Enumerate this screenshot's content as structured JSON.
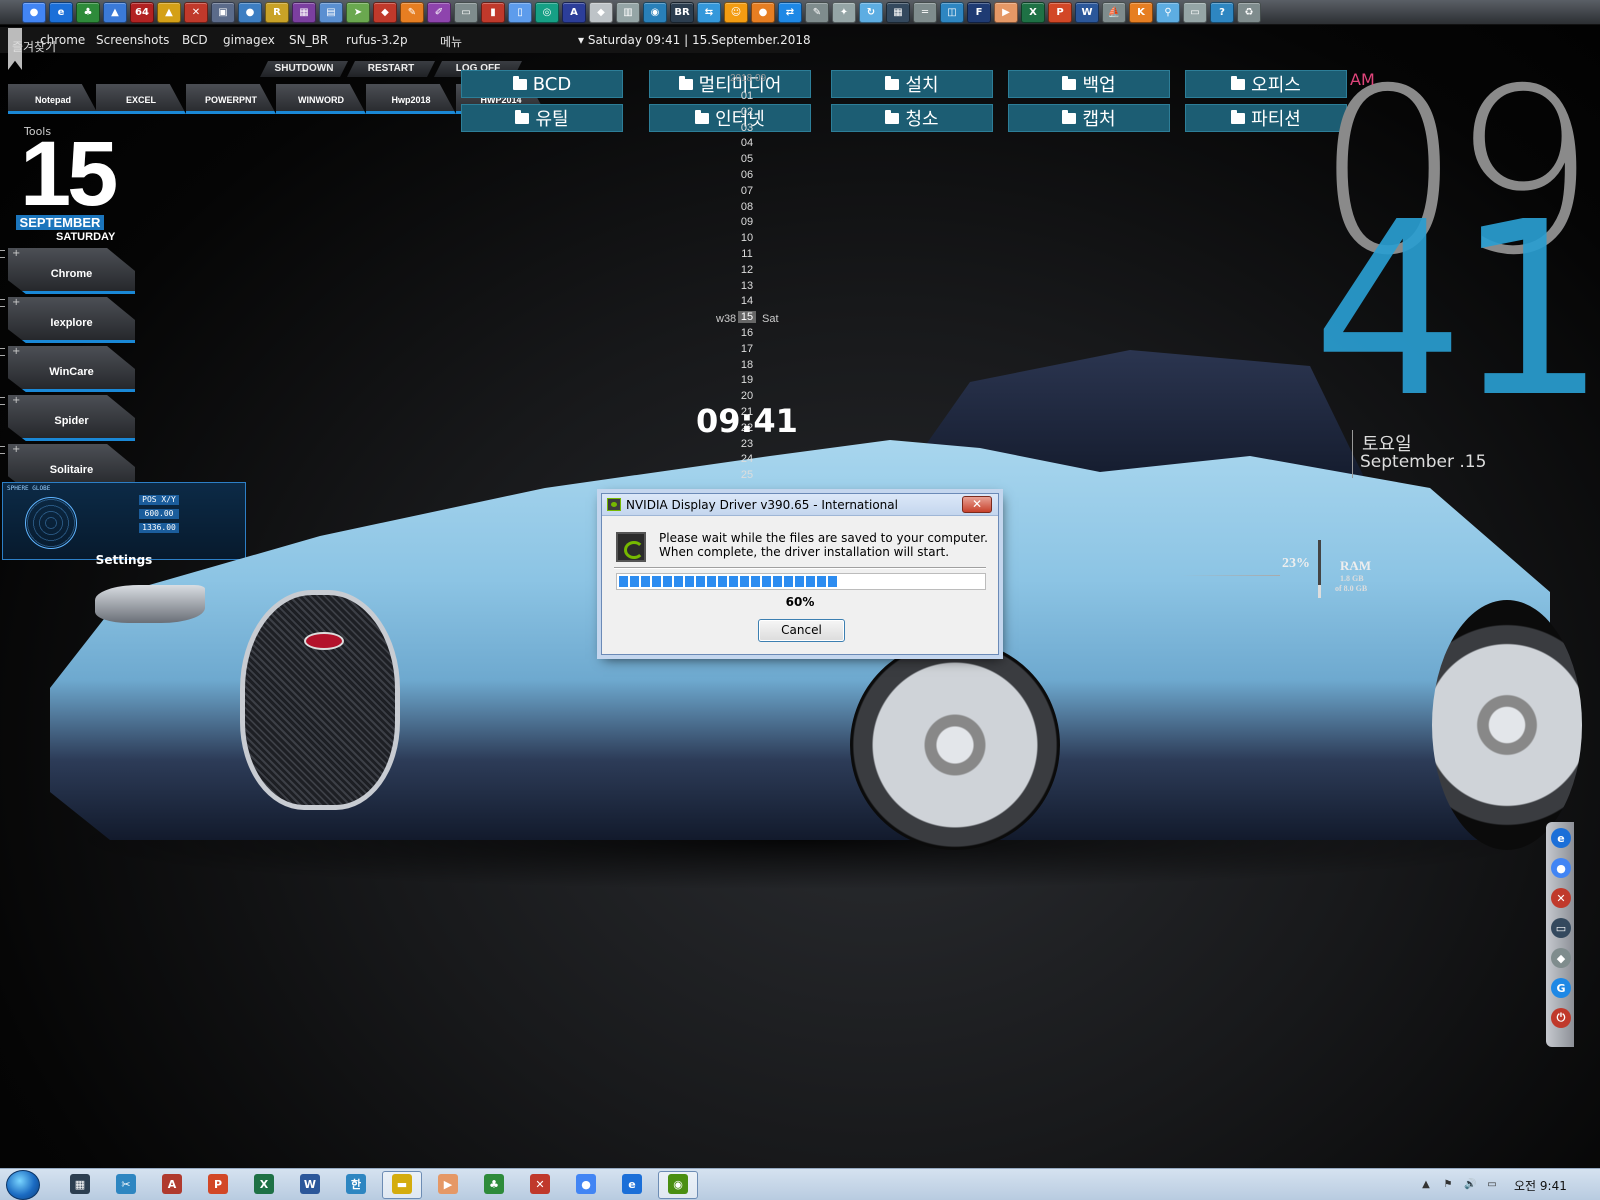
{
  "top_icons": [
    {
      "name": "chrome-icon",
      "color": "#4285f4",
      "glyph": "●"
    },
    {
      "name": "ie-icon",
      "color": "#1b6fd8",
      "glyph": "e"
    },
    {
      "name": "clover-icon",
      "color": "#2e8b3a",
      "glyph": "♣"
    },
    {
      "name": "drive-icon",
      "color": "#3b7ad8",
      "glyph": "▲"
    },
    {
      "name": "cpu64-icon",
      "color": "#b22222",
      "glyph": "64"
    },
    {
      "name": "hazard-icon",
      "color": "#d4a017",
      "glyph": "▲"
    },
    {
      "name": "tool-icon",
      "color": "#c0392b",
      "glyph": "✕"
    },
    {
      "name": "scanner-icon",
      "color": "#5b6b8a",
      "glyph": "▣"
    },
    {
      "name": "drop-icon",
      "color": "#3d7ec2",
      "glyph": "●"
    },
    {
      "name": "r-icon",
      "color": "#c9a227",
      "glyph": "R"
    },
    {
      "name": "rar-icon",
      "color": "#7b3fa0",
      "glyph": "▦"
    },
    {
      "name": "disk-icon",
      "color": "#5a8fd1",
      "glyph": "▤"
    },
    {
      "name": "bird-icon",
      "color": "#6aa84f",
      "glyph": "➤"
    },
    {
      "name": "shield-icon",
      "color": "#c0392b",
      "glyph": "◆"
    },
    {
      "name": "pen-icon",
      "color": "#e67e22",
      "glyph": "✎"
    },
    {
      "name": "brush-icon",
      "color": "#8e44ad",
      "glyph": "✐"
    },
    {
      "name": "card-icon",
      "color": "#7f8c8d",
      "glyph": "▭"
    },
    {
      "name": "paper-icon",
      "color": "#c0392b",
      "glyph": "▮"
    },
    {
      "name": "doc-icon",
      "color": "#5d9cec",
      "glyph": "▯"
    },
    {
      "name": "cd-icon",
      "color": "#16a085",
      "glyph": "◎"
    },
    {
      "name": "a-icon",
      "color": "#2c3e99",
      "glyph": "A"
    },
    {
      "name": "diamond-icon",
      "color": "#bdc3c7",
      "glyph": "◆"
    },
    {
      "name": "printer-icon",
      "color": "#95a5a6",
      "glyph": "▥"
    },
    {
      "name": "globe-icon",
      "color": "#2980b9",
      "glyph": "◉"
    },
    {
      "name": "br-icon",
      "color": "#2c3e50",
      "glyph": "BR"
    },
    {
      "name": "net-icon",
      "color": "#3498db",
      "glyph": "⇆"
    },
    {
      "name": "users-icon",
      "color": "#f39c12",
      "glyph": "☺"
    },
    {
      "name": "orange-icon",
      "color": "#e67e22",
      "glyph": "●"
    },
    {
      "name": "remote-icon",
      "color": "#1e88e5",
      "glyph": "⇄"
    },
    {
      "name": "pencil-icon",
      "color": "#7f8c8d",
      "glyph": "✎"
    },
    {
      "name": "wand-icon",
      "color": "#95a5a6",
      "glyph": "✦"
    },
    {
      "name": "refresh-icon",
      "color": "#5dade2",
      "glyph": "↻"
    },
    {
      "name": "calc-icon",
      "color": "#34495e",
      "glyph": "▦"
    },
    {
      "name": "pipe-icon",
      "color": "#7f8c8d",
      "glyph": "═"
    },
    {
      "name": "panel-icon",
      "color": "#2e86c1",
      "glyph": "◫"
    },
    {
      "name": "f-icon",
      "color": "#1f3b73",
      "glyph": "F"
    },
    {
      "name": "play-icon",
      "color": "#e59866",
      "glyph": "▶"
    },
    {
      "name": "excel-icon",
      "color": "#1e7145",
      "glyph": "X"
    },
    {
      "name": "ppt-icon",
      "color": "#d24726",
      "glyph": "P"
    },
    {
      "name": "word-icon",
      "color": "#2b579a",
      "glyph": "W"
    },
    {
      "name": "ship-icon",
      "color": "#7f8c8d",
      "glyph": "⛵"
    },
    {
      "name": "k-icon",
      "color": "#e67e22",
      "glyph": "K"
    },
    {
      "name": "magnify-icon",
      "color": "#5dade2",
      "glyph": "⚲"
    },
    {
      "name": "monitor-icon",
      "color": "#95a5a6",
      "glyph": "▭"
    },
    {
      "name": "help-icon",
      "color": "#2e86c1",
      "glyph": "?"
    },
    {
      "name": "recycle-icon",
      "color": "#7f8c8d",
      "glyph": "♻"
    }
  ],
  "menu": {
    "shortcut_korean": "즐겨찾기",
    "items": [
      "chrome",
      "Screenshots",
      "BCD",
      "gimagex",
      "SN_BR",
      "rufus-3.2p",
      "메뉴"
    ],
    "clock": "▾ Saturday 09:41 | 15.September.2018"
  },
  "power_buttons": [
    "SHUTDOWN",
    "RESTART",
    "LOG OFF"
  ],
  "app_tabs": [
    "Notepad",
    "EXCEL",
    "POWERPNT",
    "WINWORD",
    "Hwp2018",
    "HWP2014"
  ],
  "folders": [
    [
      "BCD",
      "멀티미디어",
      "설치",
      "백업",
      "오피스"
    ],
    [
      "유틸",
      "인터넷",
      "청소",
      "캡처",
      "파티션"
    ]
  ],
  "date_widget": {
    "tools_label": "Tools",
    "day": "15",
    "month": "SEPTEMBER",
    "weekday": "SATURDAY"
  },
  "launchers": [
    "Chrome",
    "Iexplore",
    "WinCare",
    "Spider",
    "Solitaire"
  ],
  "globe": {
    "title": "SPHERE GLOBE",
    "values": [
      "POS X/Y",
      "600.00",
      "1336.00"
    ],
    "settings_label": "Settings"
  },
  "calendar": {
    "header": "2018 09",
    "days": [
      "01",
      "02",
      "03",
      "04",
      "05",
      "06",
      "07",
      "08",
      "09",
      "10",
      "11",
      "12",
      "13",
      "14",
      "15",
      "16",
      "17",
      "18",
      "19",
      "20",
      "21",
      "22",
      "23",
      "24",
      "25"
    ],
    "week_label": "w38",
    "today": "15",
    "today_dow": "Sat"
  },
  "center_clock": "09:41",
  "right_clock": {
    "ampm": "AM",
    "hour": "09",
    "minute": "41",
    "weekday_korean": "토요일",
    "date": "September .15"
  },
  "ram": {
    "percent": "23%",
    "label": "RAM",
    "used": "1.8 GB",
    "total": "of 8.0 GB",
    "fill_fraction": 0.23
  },
  "dock_icons": [
    {
      "name": "ie-icon",
      "color": "#1b6fd8",
      "glyph": "e"
    },
    {
      "name": "chrome-icon",
      "color": "#4285f4",
      "glyph": "●"
    },
    {
      "name": "tool-icon",
      "color": "#c0392b",
      "glyph": "✕"
    },
    {
      "name": "monitor-icon",
      "color": "#34495e",
      "glyph": "▭"
    },
    {
      "name": "diamond-icon",
      "color": "#7f8c8d",
      "glyph": "◆"
    },
    {
      "name": "g-icon",
      "color": "#1e88e5",
      "glyph": "G"
    },
    {
      "name": "power-icon",
      "color": "#c0392b",
      "glyph": "⏻"
    }
  ],
  "dialog": {
    "title": "NVIDIA Display Driver v390.65 - International",
    "close": "✕",
    "message_line1": "Please wait while the files are saved to your computer.",
    "message_line2": "When complete, the driver installation will start.",
    "progress_fraction": 0.6,
    "progress_text": "60%",
    "cancel": "Cancel"
  },
  "taskbar": {
    "icons": [
      {
        "name": "apps-icon",
        "color": "#2c3e50",
        "glyph": "▦"
      },
      {
        "name": "snip-icon",
        "color": "#2e86c1",
        "glyph": "✂"
      },
      {
        "name": "pdf-icon",
        "color": "#b03a2e",
        "glyph": "A"
      },
      {
        "name": "ppt-icon",
        "color": "#d24726",
        "glyph": "P"
      },
      {
        "name": "excel-icon",
        "color": "#1e7145",
        "glyph": "X"
      },
      {
        "name": "word-icon",
        "color": "#2b579a",
        "glyph": "W"
      },
      {
        "name": "hancom-icon",
        "color": "#2e86c1",
        "glyph": "한"
      },
      {
        "name": "explorer-icon",
        "color": "#d4ac0d",
        "glyph": "▬"
      },
      {
        "name": "media-icon",
        "color": "#e59866",
        "glyph": "▶"
      },
      {
        "name": "clover-icon",
        "color": "#2e8b3a",
        "glyph": "♣"
      },
      {
        "name": "tool-icon",
        "color": "#c0392b",
        "glyph": "✕"
      },
      {
        "name": "chrome-icon",
        "color": "#4285f4",
        "glyph": "●"
      },
      {
        "name": "ie-icon",
        "color": "#1b6fd8",
        "glyph": "e"
      },
      {
        "name": "nvidia-icon",
        "color": "#4a8f12",
        "glyph": "◉"
      }
    ],
    "tray": [
      "▲",
      "⚑",
      "🔊",
      "▭"
    ],
    "clock": "오전 9:41"
  }
}
